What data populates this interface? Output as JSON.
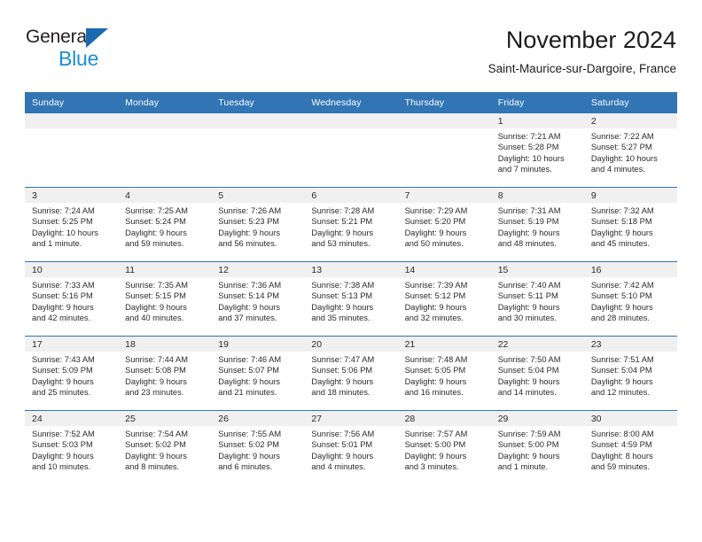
{
  "brand": {
    "line1": "General",
    "line2": "Blue",
    "triangle_color": "#1b69b2",
    "blue_text_color": "#1b8fd4"
  },
  "header": {
    "title": "November 2024",
    "subtitle": "Saint-Maurice-sur-Dargoire, France"
  },
  "theme": {
    "header_blue": "#3175b5",
    "daynum_strip": "#f0f0f0",
    "text": "#2b2b2b"
  },
  "weekdays": [
    "Sunday",
    "Monday",
    "Tuesday",
    "Wednesday",
    "Thursday",
    "Friday",
    "Saturday"
  ],
  "labels": {
    "sunrise_prefix": "Sunrise:",
    "sunset_prefix": "Sunset:",
    "daylight_prefix": "Daylight:"
  },
  "weeks": [
    [
      {
        "day": "",
        "empty": true
      },
      {
        "day": "",
        "empty": true
      },
      {
        "day": "",
        "empty": true
      },
      {
        "day": "",
        "empty": true
      },
      {
        "day": "",
        "empty": true
      },
      {
        "day": "1",
        "sunrise": "Sunrise: 7:21 AM",
        "sunset": "Sunset: 5:28 PM",
        "daylight_line1": "Daylight: 10 hours",
        "daylight_line2": "and 7 minutes."
      },
      {
        "day": "2",
        "sunrise": "Sunrise: 7:22 AM",
        "sunset": "Sunset: 5:27 PM",
        "daylight_line1": "Daylight: 10 hours",
        "daylight_line2": "and 4 minutes."
      }
    ],
    [
      {
        "day": "3",
        "sunrise": "Sunrise: 7:24 AM",
        "sunset": "Sunset: 5:25 PM",
        "daylight_line1": "Daylight: 10 hours",
        "daylight_line2": "and 1 minute."
      },
      {
        "day": "4",
        "sunrise": "Sunrise: 7:25 AM",
        "sunset": "Sunset: 5:24 PM",
        "daylight_line1": "Daylight: 9 hours",
        "daylight_line2": "and 59 minutes."
      },
      {
        "day": "5",
        "sunrise": "Sunrise: 7:26 AM",
        "sunset": "Sunset: 5:23 PM",
        "daylight_line1": "Daylight: 9 hours",
        "daylight_line2": "and 56 minutes."
      },
      {
        "day": "6",
        "sunrise": "Sunrise: 7:28 AM",
        "sunset": "Sunset: 5:21 PM",
        "daylight_line1": "Daylight: 9 hours",
        "daylight_line2": "and 53 minutes."
      },
      {
        "day": "7",
        "sunrise": "Sunrise: 7:29 AM",
        "sunset": "Sunset: 5:20 PM",
        "daylight_line1": "Daylight: 9 hours",
        "daylight_line2": "and 50 minutes."
      },
      {
        "day": "8",
        "sunrise": "Sunrise: 7:31 AM",
        "sunset": "Sunset: 5:19 PM",
        "daylight_line1": "Daylight: 9 hours",
        "daylight_line2": "and 48 minutes."
      },
      {
        "day": "9",
        "sunrise": "Sunrise: 7:32 AM",
        "sunset": "Sunset: 5:18 PM",
        "daylight_line1": "Daylight: 9 hours",
        "daylight_line2": "and 45 minutes."
      }
    ],
    [
      {
        "day": "10",
        "sunrise": "Sunrise: 7:33 AM",
        "sunset": "Sunset: 5:16 PM",
        "daylight_line1": "Daylight: 9 hours",
        "daylight_line2": "and 42 minutes."
      },
      {
        "day": "11",
        "sunrise": "Sunrise: 7:35 AM",
        "sunset": "Sunset: 5:15 PM",
        "daylight_line1": "Daylight: 9 hours",
        "daylight_line2": "and 40 minutes."
      },
      {
        "day": "12",
        "sunrise": "Sunrise: 7:36 AM",
        "sunset": "Sunset: 5:14 PM",
        "daylight_line1": "Daylight: 9 hours",
        "daylight_line2": "and 37 minutes."
      },
      {
        "day": "13",
        "sunrise": "Sunrise: 7:38 AM",
        "sunset": "Sunset: 5:13 PM",
        "daylight_line1": "Daylight: 9 hours",
        "daylight_line2": "and 35 minutes."
      },
      {
        "day": "14",
        "sunrise": "Sunrise: 7:39 AM",
        "sunset": "Sunset: 5:12 PM",
        "daylight_line1": "Daylight: 9 hours",
        "daylight_line2": "and 32 minutes."
      },
      {
        "day": "15",
        "sunrise": "Sunrise: 7:40 AM",
        "sunset": "Sunset: 5:11 PM",
        "daylight_line1": "Daylight: 9 hours",
        "daylight_line2": "and 30 minutes."
      },
      {
        "day": "16",
        "sunrise": "Sunrise: 7:42 AM",
        "sunset": "Sunset: 5:10 PM",
        "daylight_line1": "Daylight: 9 hours",
        "daylight_line2": "and 28 minutes."
      }
    ],
    [
      {
        "day": "17",
        "sunrise": "Sunrise: 7:43 AM",
        "sunset": "Sunset: 5:09 PM",
        "daylight_line1": "Daylight: 9 hours",
        "daylight_line2": "and 25 minutes."
      },
      {
        "day": "18",
        "sunrise": "Sunrise: 7:44 AM",
        "sunset": "Sunset: 5:08 PM",
        "daylight_line1": "Daylight: 9 hours",
        "daylight_line2": "and 23 minutes."
      },
      {
        "day": "19",
        "sunrise": "Sunrise: 7:46 AM",
        "sunset": "Sunset: 5:07 PM",
        "daylight_line1": "Daylight: 9 hours",
        "daylight_line2": "and 21 minutes."
      },
      {
        "day": "20",
        "sunrise": "Sunrise: 7:47 AM",
        "sunset": "Sunset: 5:06 PM",
        "daylight_line1": "Daylight: 9 hours",
        "daylight_line2": "and 18 minutes."
      },
      {
        "day": "21",
        "sunrise": "Sunrise: 7:48 AM",
        "sunset": "Sunset: 5:05 PM",
        "daylight_line1": "Daylight: 9 hours",
        "daylight_line2": "and 16 minutes."
      },
      {
        "day": "22",
        "sunrise": "Sunrise: 7:50 AM",
        "sunset": "Sunset: 5:04 PM",
        "daylight_line1": "Daylight: 9 hours",
        "daylight_line2": "and 14 minutes."
      },
      {
        "day": "23",
        "sunrise": "Sunrise: 7:51 AM",
        "sunset": "Sunset: 5:04 PM",
        "daylight_line1": "Daylight: 9 hours",
        "daylight_line2": "and 12 minutes."
      }
    ],
    [
      {
        "day": "24",
        "sunrise": "Sunrise: 7:52 AM",
        "sunset": "Sunset: 5:03 PM",
        "daylight_line1": "Daylight: 9 hours",
        "daylight_line2": "and 10 minutes."
      },
      {
        "day": "25",
        "sunrise": "Sunrise: 7:54 AM",
        "sunset": "Sunset: 5:02 PM",
        "daylight_line1": "Daylight: 9 hours",
        "daylight_line2": "and 8 minutes."
      },
      {
        "day": "26",
        "sunrise": "Sunrise: 7:55 AM",
        "sunset": "Sunset: 5:02 PM",
        "daylight_line1": "Daylight: 9 hours",
        "daylight_line2": "and 6 minutes."
      },
      {
        "day": "27",
        "sunrise": "Sunrise: 7:56 AM",
        "sunset": "Sunset: 5:01 PM",
        "daylight_line1": "Daylight: 9 hours",
        "daylight_line2": "and 4 minutes."
      },
      {
        "day": "28",
        "sunrise": "Sunrise: 7:57 AM",
        "sunset": "Sunset: 5:00 PM",
        "daylight_line1": "Daylight: 9 hours",
        "daylight_line2": "and 3 minutes."
      },
      {
        "day": "29",
        "sunrise": "Sunrise: 7:59 AM",
        "sunset": "Sunset: 5:00 PM",
        "daylight_line1": "Daylight: 9 hours",
        "daylight_line2": "and 1 minute."
      },
      {
        "day": "30",
        "sunrise": "Sunrise: 8:00 AM",
        "sunset": "Sunset: 4:59 PM",
        "daylight_line1": "Daylight: 8 hours",
        "daylight_line2": "and 59 minutes."
      }
    ]
  ]
}
